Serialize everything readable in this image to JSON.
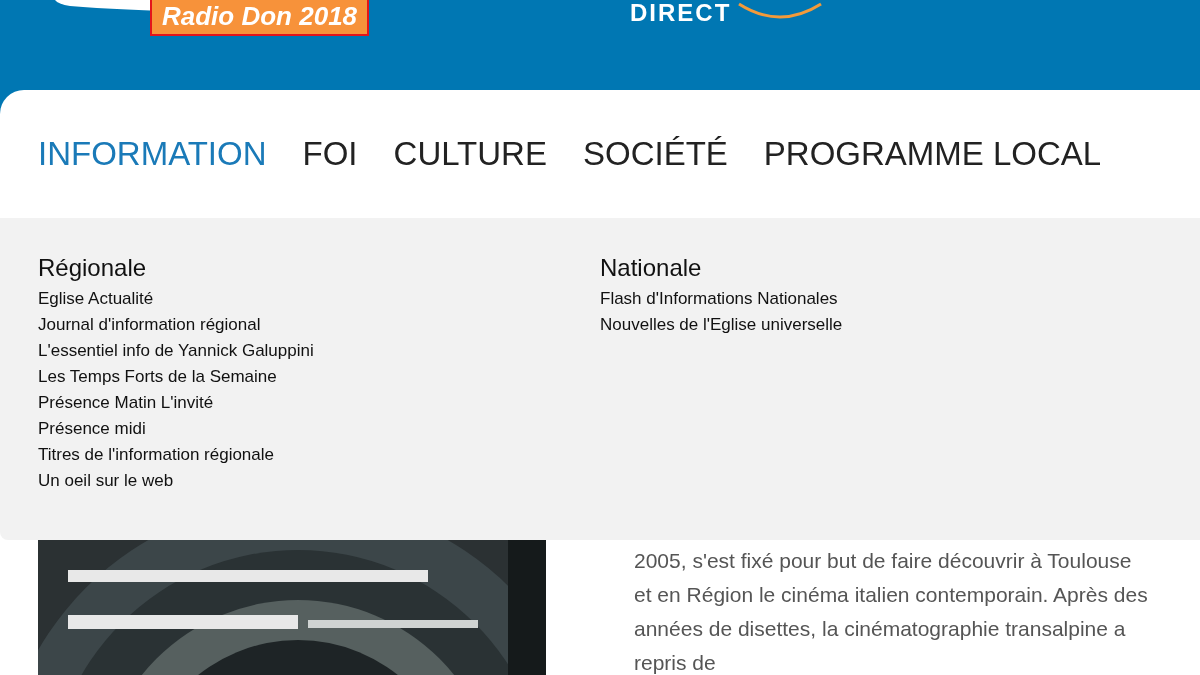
{
  "header": {
    "badge": "Radio Don 2018",
    "live_label": "DIRECT"
  },
  "nav": [
    {
      "label": "INFORMATION",
      "selected": true
    },
    {
      "label": "FOI",
      "selected": false
    },
    {
      "label": "CULTURE",
      "selected": false
    },
    {
      "label": "SOCIÉTÉ",
      "selected": false
    },
    {
      "label": "PROGRAMME LOCAL",
      "selected": false
    }
  ],
  "menu": [
    {
      "heading": "Régionale",
      "links": [
        "Eglise Actualité",
        "Journal d'information régional",
        "L'essentiel info de Yannick Galuppini",
        "Les Temps Forts de la Semaine",
        "Présence Matin L'invité",
        "Présence midi",
        "Titres de l'information régionale",
        "Un oeil sur le web"
      ]
    },
    {
      "heading": "Nationale",
      "links": [
        "Flash d'Informations Nationales",
        "Nouvelles de l'Eglise universelle"
      ]
    }
  ],
  "article": {
    "text": "2005, s'est fixé pour but de faire découvrir à Toulouse et en Région le cinéma italien contemporain. Après des années de disettes, la cinématographie transalpine a repris de"
  }
}
